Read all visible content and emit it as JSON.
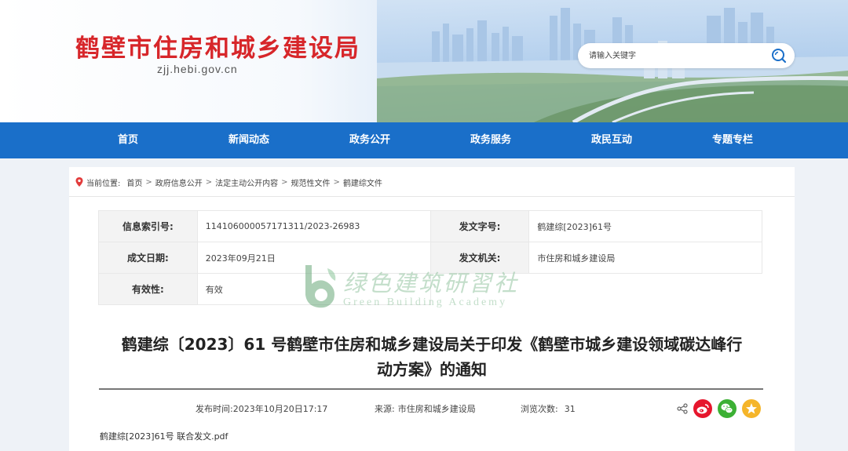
{
  "header": {
    "site_title": "鹤壁市住房和城乡建设局",
    "site_domain": "zjj.hebi.gov.cn",
    "search_placeholder": "请输入关键字"
  },
  "nav": {
    "items": [
      "首页",
      "新闻动态",
      "政务公开",
      "政务服务",
      "政民互动",
      "专题专栏"
    ]
  },
  "breadcrumb": {
    "label": "当前位置:",
    "items": [
      "首页",
      "政府信息公开",
      "法定主动公开内容",
      "规范性文件",
      "鹤建综文件"
    ],
    "separator": ">"
  },
  "info_table": {
    "rows": [
      [
        {
          "label": "信息索引号:",
          "value": "114106000057171311/2023-26983"
        },
        {
          "label": "发文字号:",
          "value": "鹤建综[2023]61号"
        }
      ],
      [
        {
          "label": "成文日期:",
          "value": "2023年09月21日"
        },
        {
          "label": "发文机关:",
          "value": "市住房和城乡建设局"
        }
      ],
      [
        {
          "label": "有效性:",
          "value": "有效"
        }
      ]
    ]
  },
  "watermark": {
    "cn": "绿色建筑研習社",
    "en": "Green Building Academy"
  },
  "article": {
    "title_line1": "鹤建综〔2023〕61 号鹤壁市住房和城乡建设局关于印发《鹤壁市城乡建设领域碳达峰行",
    "title_line2": "动方案》的通知",
    "publish_label": "发布时间:",
    "publish_time": "2023年10月20日17:17",
    "source_label": "来源:",
    "source": "市住房和城乡建设局",
    "views_label": "浏览次数:",
    "views": "31",
    "attachment": "鹤建综[2023]61号 联合发文.pdf"
  },
  "colors": {
    "brand_red": "#d7262a",
    "nav_blue": "#1a6fc9",
    "weibo": "#e6162d",
    "wechat": "#3cb034",
    "qzone": "#f5b52a"
  }
}
